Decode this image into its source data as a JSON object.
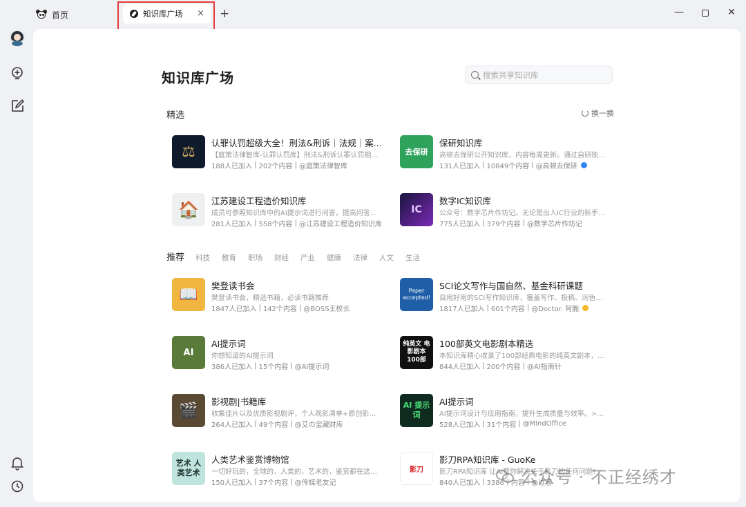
{
  "tabs": {
    "home_label": "首页",
    "active_label": "知识库广场",
    "close_glyph": "×",
    "add_glyph": "+"
  },
  "window": {
    "minimize": "—",
    "close": "✕"
  },
  "page": {
    "title": "知识库广场",
    "search_placeholder": "搜索共享知识库"
  },
  "featured": {
    "title": "精选",
    "refresh_label": "换一换",
    "items": [
      {
        "name": "认罪认罚超级大全！刑法&刑诉｜法规｜案...",
        "desc": "【庭策法律智库-认罪认罚库】刑法&刑诉认罪认罚相关...",
        "joined": "188人已加入",
        "count": "202个内容",
        "author": "@庭策法律智库",
        "badge": ""
      },
      {
        "name": "保研知识库",
        "desc": "高顿去保研公开知识库，内容每周更新。通过自研独家...",
        "joined": "131人已加入",
        "count": "10849个内容",
        "author": "@高顿去保研",
        "badge": "blue"
      },
      {
        "name": "江苏建设工程造价知识库",
        "desc": "成员可参照知识库中的AI提示词进行问答，提高问答效...",
        "joined": "281人已加入",
        "count": "558个内容",
        "author": "@江苏建设工程造价知识库",
        "badge": ""
      },
      {
        "name": "数字IC知识库",
        "desc": "公众号：数字芯片作坊记。无论是出入IC行业的新手，...",
        "joined": "775人已加入",
        "count": "379个内容",
        "author": "@数字芯片作坊记",
        "badge": ""
      }
    ]
  },
  "recommend": {
    "title": "推荐",
    "categories": [
      "科技",
      "教育",
      "职场",
      "财经",
      "产业",
      "健康",
      "法律",
      "人文",
      "生活"
    ],
    "items": [
      {
        "name": "樊登读书会",
        "desc": "樊登读书会，精选书籍，必读书籍推荐",
        "joined": "1847人已加入",
        "count": "142个内容",
        "author": "@BOSS王校长",
        "badge": ""
      },
      {
        "name": "SCI论文写作与国自然、基金科研课题",
        "desc": "自用好用的SCI写作知识库，覆盖写作、投稿、润色、选...",
        "joined": "1817人已加入",
        "count": "601个内容",
        "author": "@Doctor. 阿脆",
        "badge": "gold"
      },
      {
        "name": "AI提示词",
        "desc": "你想知道的AI提示词",
        "joined": "386人已加入",
        "count": "15个内容",
        "author": "@AI提示词",
        "badge": ""
      },
      {
        "name": "100部英文电影剧本精选",
        "desc": "本知识库精心收录了100部经典电影的纯英文剧本，旨...",
        "joined": "844人已加入",
        "count": "200个内容",
        "author": "@AI指南针",
        "badge": ""
      },
      {
        "name": "影视剧|书籍库",
        "desc": "收集佳片以及优质影视剧评，个人观影清单+原创影视...",
        "joined": "264人已加入",
        "count": "49个内容",
        "author": "@艾の宝藏财库",
        "badge": ""
      },
      {
        "name": "AI提示词",
        "desc": "AI提示词设计与应用指南，提升生成质量与效率。>>>...",
        "joined": "528人已加入",
        "count": "31个内容",
        "author": "@MindOffice",
        "badge": ""
      },
      {
        "name": "人类艺术鉴赏博物馆",
        "desc": "一切好玩的，全球的，人类的，艺术的，鉴赏都在这里...",
        "joined": "150人已加入",
        "count": "37个内容",
        "author": "@传媒老友记",
        "badge": ""
      },
      {
        "name": "影刀RPA知识库 - GuoKe",
        "desc": "影刀RPA知识库 让AI帮你解决关于影刀的任何问题!",
        "joined": "840人已加入",
        "count": "3386个内容",
        "author": "@过客",
        "badge": ""
      }
    ]
  },
  "thumbs": {
    "featured": [
      "⚖",
      "去保研",
      "🏠",
      "IC"
    ],
    "recommend": [
      "📖",
      "Paper accepted!",
      "AI",
      "纯英文 电影剧本 100部",
      "🎬",
      "AI 提示词",
      "艺术 人类艺术",
      "影刀"
    ]
  },
  "colors": {
    "highlight": "#e5393b",
    "badge_blue": "#2f86f6",
    "badge_gold": "#f4b928"
  },
  "watermark": "公众号 · 不正经绣才"
}
